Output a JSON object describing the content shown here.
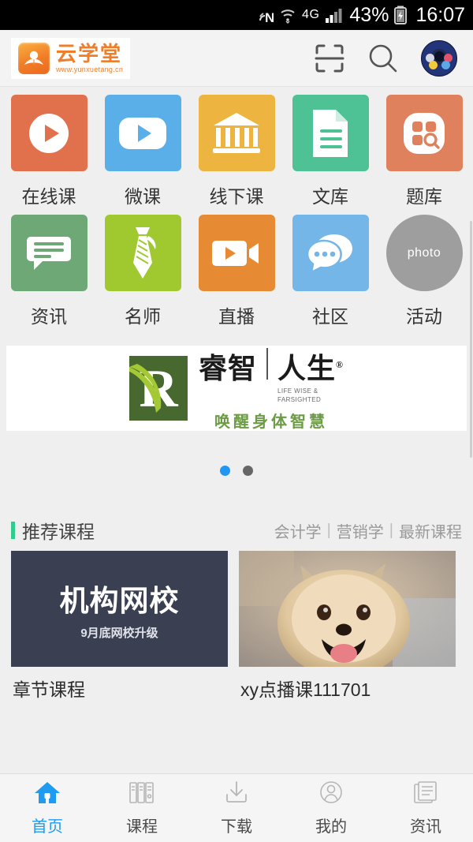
{
  "statusbar": {
    "nfc_icon": "nfc-icon",
    "wifi_icon": "wifi-icon",
    "network_label": "4G",
    "signal_icon": "signal-bars-icon",
    "battery_percent": "43%",
    "battery_icon": "battery-charging-icon",
    "clock": "16:07"
  },
  "appbar": {
    "logo_icon": "open-book-icon",
    "logo_title": "云学堂",
    "logo_url": "www.yunxuetang.cn",
    "scan_icon": "qr-scan-icon",
    "search_icon": "search-icon",
    "avatar_icon": "user-avatar"
  },
  "grid": {
    "rows": [
      [
        {
          "label": "在线课",
          "icon": "play-circle-icon",
          "color": "#e0714c"
        },
        {
          "label": "微课",
          "icon": "video-play-icon",
          "color": "#5aafe8"
        },
        {
          "label": "线下课",
          "icon": "bank-columns-icon",
          "color": "#eeb440"
        },
        {
          "label": "文库",
          "icon": "document-icon",
          "color": "#4ec295"
        },
        {
          "label": "题库",
          "icon": "grid-search-icon",
          "color": "#e0815e"
        }
      ],
      [
        {
          "label": "资讯",
          "icon": "chat-lines-icon",
          "color": "#6fa877"
        },
        {
          "label": "名师",
          "icon": "necktie-icon",
          "color": "#a0c930"
        },
        {
          "label": "直播",
          "icon": "video-camera-icon",
          "color": "#e78a34"
        },
        {
          "label": "社区",
          "icon": "chat-bubbles-icon",
          "color": "#73b6e7"
        },
        {
          "label": "活动",
          "icon": "photo-placeholder",
          "color": "#9e9e9e",
          "placeholder_text": "photo",
          "shape": "circle"
        }
      ]
    ]
  },
  "banner": {
    "logo_letter": "R",
    "logo_icon": "ruizhi-logo",
    "title_left": "睿智",
    "title_right": "人生",
    "registered_mark": "®",
    "tagline_en_line1": "LIFE WISE &",
    "tagline_en_line2": "FARSIGHTED",
    "tagline_cn": "唤醒身体智慧",
    "dots": [
      {
        "active": true,
        "color": "#2196f3"
      },
      {
        "active": false,
        "color": "#666666"
      }
    ]
  },
  "recommended": {
    "title": "推荐课程",
    "accent_color": "#2ecc8f",
    "links": [
      "会计学",
      "营销学",
      "最新课程"
    ],
    "separator": "|",
    "cards": [
      {
        "thumb_type": "dark-text",
        "thumb_title": "机构网校",
        "thumb_subtitle": "9月底网校升级",
        "title": "章节课程"
      },
      {
        "thumb_type": "photo",
        "thumb_alt": "pomeranian-dog-photo",
        "title": "xy点播课111701"
      }
    ]
  },
  "tabbar": {
    "tabs": [
      {
        "label": "首页",
        "icon": "home-icon",
        "active": true
      },
      {
        "label": "课程",
        "icon": "books-icon",
        "active": false
      },
      {
        "label": "下载",
        "icon": "download-icon",
        "active": false
      },
      {
        "label": "我的",
        "icon": "person-icon",
        "active": false
      },
      {
        "label": "资讯",
        "icon": "news-icon",
        "active": false
      }
    ],
    "active_color": "#1f9cf0",
    "inactive_color": "#9a9a9a"
  }
}
